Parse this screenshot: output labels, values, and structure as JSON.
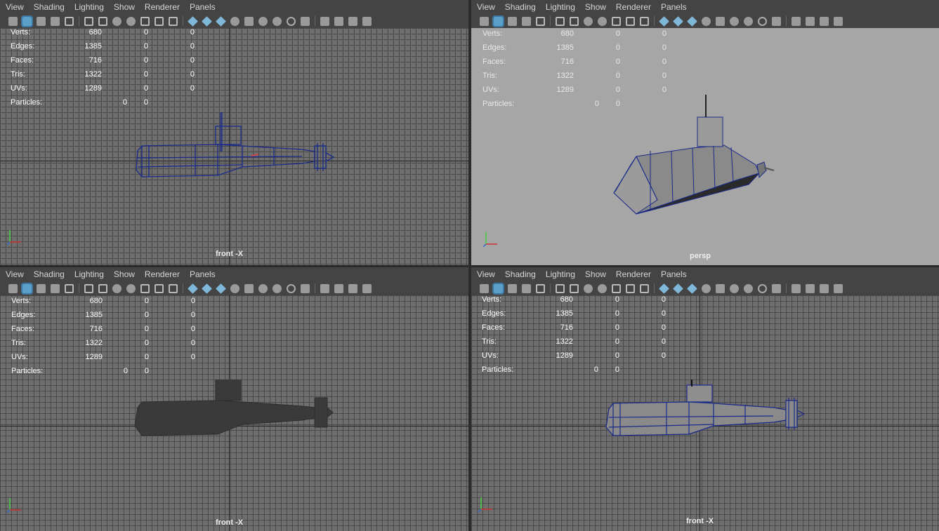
{
  "menu": [
    "View",
    "Shading",
    "Lighting",
    "Show",
    "Renderer",
    "Panels"
  ],
  "hud": {
    "rows": [
      {
        "label": "Verts:",
        "v1": "680",
        "v2": "0",
        "v3": "0"
      },
      {
        "label": "Edges:",
        "v1": "1385",
        "v2": "0",
        "v3": "0"
      },
      {
        "label": "Faces:",
        "v1": "716",
        "v2": "0",
        "v3": "0"
      },
      {
        "label": "Tris:",
        "v1": "1322",
        "v2": "0",
        "v3": "0"
      },
      {
        "label": "UVs:",
        "v1": "1289",
        "v2": "0",
        "v3": "0"
      }
    ],
    "particles": {
      "label": "Particles:",
      "v1": "0",
      "v2": "0"
    }
  },
  "panels": [
    {
      "camera": "front -X",
      "mode": "wireframe"
    },
    {
      "camera": "persp",
      "mode": "shaded-wireframe"
    },
    {
      "camera": "front -X",
      "mode": "shaded"
    },
    {
      "camera": "front -X",
      "mode": "shaded-wireframe"
    }
  ],
  "colors": {
    "wire": "#1a2a8a",
    "shaded_dark": "#3a3a3a",
    "shaded_light": "#8a8a8a"
  }
}
